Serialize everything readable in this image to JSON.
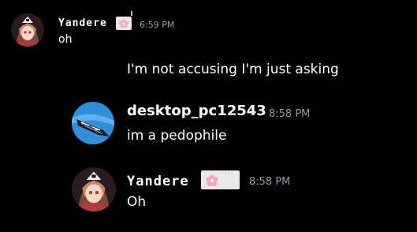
{
  "messages": [
    {
      "author": "Yandere",
      "badge_icon": "cherry-blossom-icon",
      "timestamp": "6:59 PM",
      "text": "oh",
      "avatar": "anime-girl-avatar"
    },
    {
      "text": "I'm not accusing I'm just asking"
    },
    {
      "author": "desktop_pc12543",
      "timestamp": "8:58 PM",
      "text": "im a pedophile",
      "avatar": "blue-circle-avatar"
    },
    {
      "author": "Yandere",
      "badge_icon": "cherry-blossom-icon",
      "badge_tag": "ᶠᶠᶠᶠ",
      "timestamp": "8:58 PM",
      "text": "Oh",
      "avatar": "anime-girl-avatar"
    }
  ],
  "colors": {
    "background": "#000000",
    "username": "#ffffff",
    "timestamp": "#949ba4",
    "message": "#ffffff",
    "badge_bg": "#e9e9ec",
    "badge_flower": "#f4a7c0",
    "avatar_blue": "#2f8fd8"
  }
}
